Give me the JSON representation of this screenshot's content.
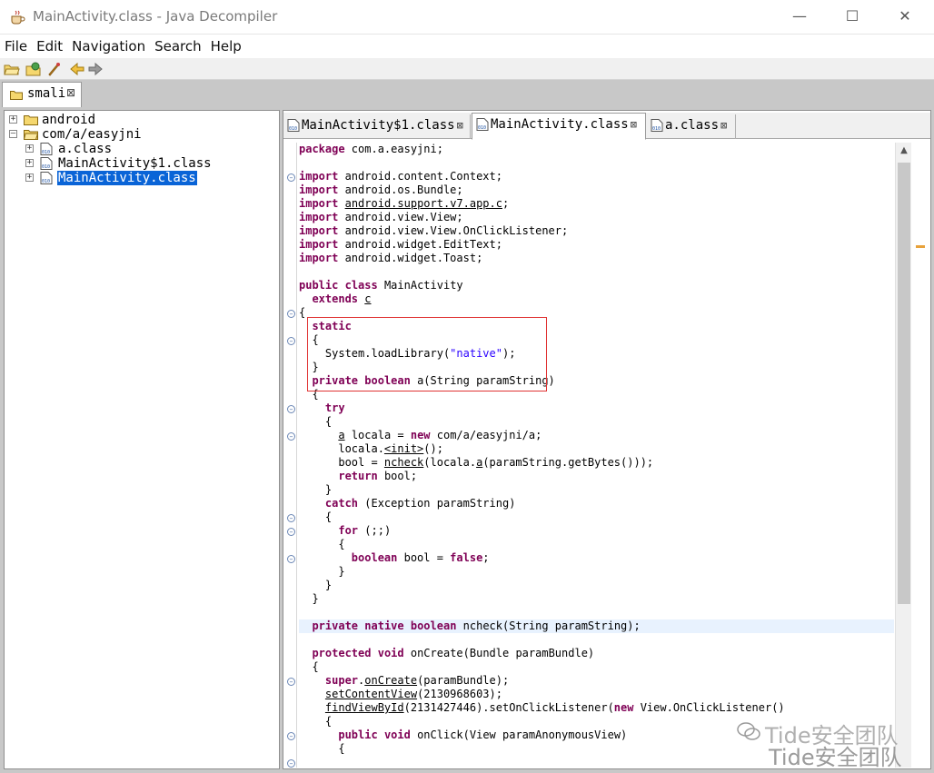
{
  "window": {
    "title": "MainActivity.class - Java Decompiler"
  },
  "menu": [
    "File",
    "Edit",
    "Navigation",
    "Search",
    "Help"
  ],
  "left_tab": {
    "label": "smali"
  },
  "tree": [
    {
      "label": "android",
      "type": "package",
      "depth": 0
    },
    {
      "label": "com/a/easyjni",
      "type": "package-open",
      "depth": 0
    },
    {
      "label": "a.class",
      "type": "class",
      "depth": 1
    },
    {
      "label": "MainActivity$1.class",
      "type": "class",
      "depth": 1
    },
    {
      "label": "MainActivity.class",
      "type": "class",
      "depth": 1,
      "selected": true
    }
  ],
  "editor_tabs": [
    {
      "label": "MainActivity$1.class",
      "active": false
    },
    {
      "label": "MainActivity.class",
      "active": true
    },
    {
      "label": "a.class",
      "active": false
    }
  ],
  "code_lines": [
    "package com.a.easyjni;",
    "",
    "import android.content.Context;",
    "import android.os.Bundle;",
    "import android.support.v7.app.c;",
    "import android.view.View;",
    "import android.view.View.OnClickListener;",
    "import android.widget.EditText;",
    "import android.widget.Toast;",
    "",
    "public class MainActivity",
    "  extends c",
    "{",
    "  static",
    "  {",
    "    System.loadLibrary(\"native\");",
    "  }",
    "  private boolean a(String paramString)",
    "  {",
    "    try",
    "    {",
    "      a locala = new com/a/easyjni/a;",
    "      locala.<init>();",
    "      bool = ncheck(locala.a(paramString.getBytes()));",
    "      return bool;",
    "    }",
    "    catch (Exception paramString)",
    "    {",
    "      for (;;)",
    "      {",
    "        boolean bool = false;",
    "      }",
    "    }",
    "  }",
    "",
    "  private native boolean ncheck(String paramString);",
    "",
    "  protected void onCreate(Bundle paramBundle)",
    "  {",
    "    super.onCreate(paramBundle);",
    "    setContentView(2130968603);",
    "    findViewById(2131427446).setOnClickListener(new View.OnClickListener()",
    "    {",
    "      public void onClick(View paramAnonymousView)",
    "      {"
  ],
  "highlighted_line": 35,
  "watermark": {
    "line1": "Tide安全团队",
    "line2": "Tide安全团队"
  },
  "colors": {
    "keyword": "#7f0055",
    "string": "#2a00ff",
    "selection": "#0a64d7",
    "annotation_box": "#e03434"
  },
  "icons": {
    "app": "coffee-cup-icon",
    "toolbar": [
      "open-file-icon",
      "open-type-icon",
      "run-icon",
      "back-arrow-icon",
      "forward-arrow-icon"
    ],
    "folder": "folder-icon",
    "class": "class-file-icon"
  }
}
